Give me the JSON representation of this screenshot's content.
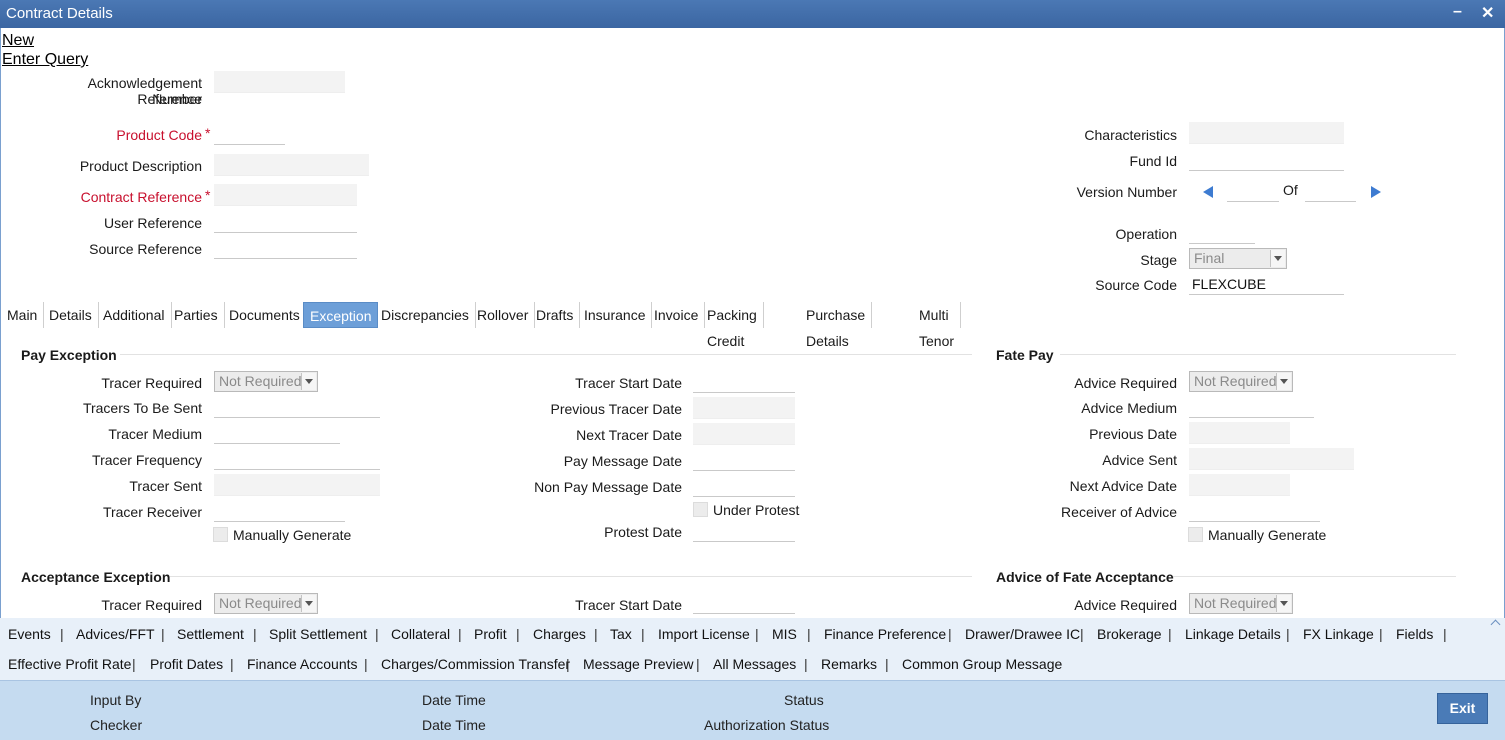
{
  "window": {
    "title": "Contract Details"
  },
  "actions": {
    "new": "New",
    "enter_query": "Enter Query"
  },
  "header": {
    "ack_ref_label_1": "Acknowledgement Reference",
    "ack_ref_label_2": "Number",
    "product_code_label": "Product Code",
    "product_description_label": "Product Description",
    "contract_reference_label": "Contract Reference",
    "user_reference_label": "User Reference",
    "source_reference_label": "Source Reference",
    "required_marker": "*",
    "characteristics_label": "Characteristics",
    "fund_id_label": "Fund Id",
    "version_number_label": "Version Number",
    "version_of_label": "Of",
    "operation_label": "Operation",
    "stage_label": "Stage",
    "stage_value": "Final",
    "source_code_label": "Source Code",
    "source_code_value": "FLEXCUBE"
  },
  "tabs": [
    "Main",
    "Details",
    "Additional",
    "Parties",
    "Documents",
    "Exception",
    "Discrepancies",
    "Rollover",
    "Drafts",
    "Insurance",
    "Invoice",
    "Packing Credit",
    "Purchase Details",
    "Multi Tenor"
  ],
  "active_tab": "Exception",
  "pay_exception": {
    "title": "Pay Exception",
    "tracer_required": "Tracer Required",
    "tracer_required_value": "Not Required",
    "tracers_to_be_sent": "Tracers To Be Sent",
    "tracer_medium": "Tracer Medium",
    "tracer_frequency": "Tracer Frequency",
    "tracer_sent": "Tracer Sent",
    "tracer_receiver": "Tracer Receiver",
    "manually_generate": "Manually Generate",
    "tracer_start_date": "Tracer Start Date",
    "previous_tracer_date": "Previous Tracer Date",
    "next_tracer_date": "Next Tracer Date",
    "pay_message_date": "Pay Message Date",
    "non_pay_message_date": "Non Pay Message Date",
    "under_protest": "Under Protest",
    "protest_date": "Protest Date"
  },
  "fate_pay": {
    "title": "Fate Pay",
    "advice_required": "Advice Required",
    "advice_required_value": "Not Required",
    "advice_medium": "Advice Medium",
    "previous_date": "Previous Date",
    "advice_sent": "Advice Sent",
    "next_advice_date": "Next Advice Date",
    "receiver_of_advice": "Receiver of Advice",
    "manually_generate": "Manually Generate"
  },
  "acceptance_exception": {
    "title": "Acceptance Exception",
    "tracer_required": "Tracer Required",
    "tracer_required_value": "Not Required",
    "tracer_start_date": "Tracer Start Date"
  },
  "advice_fate_acceptance": {
    "title": "Advice of Fate Acceptance",
    "advice_required": "Advice Required",
    "advice_required_value": "Not Required"
  },
  "bottom_links_row1": [
    "Events",
    "Advices/FFT",
    "Settlement",
    "Split Settlement",
    "Collateral",
    "Profit",
    "Charges",
    "Tax",
    "Import License",
    "MIS",
    "Finance Preference",
    "Drawer/Drawee IC",
    "Brokerage",
    "Linkage Details",
    "FX Linkage",
    "Fields"
  ],
  "bottom_links_row2": [
    "Effective Profit Rate",
    "Profit Dates",
    "Finance Accounts",
    "Charges/Commission Transfer",
    "Message Preview",
    "All Messages",
    "Remarks",
    "Common Group Message"
  ],
  "separator": "|",
  "footer": {
    "input_by": "Input By",
    "checker": "Checker",
    "date_time_1": "Date Time",
    "date_time_2": "Date Time",
    "status": "Status",
    "authorization_status": "Authorization Status",
    "exit": "Exit"
  },
  "colors": {
    "title_bar": "#3f6ba8",
    "active_tab": "#6d9fd8",
    "required_label": "#c8102e",
    "footer": "#c5dbf0",
    "exit_button": "#4a7bb7"
  }
}
